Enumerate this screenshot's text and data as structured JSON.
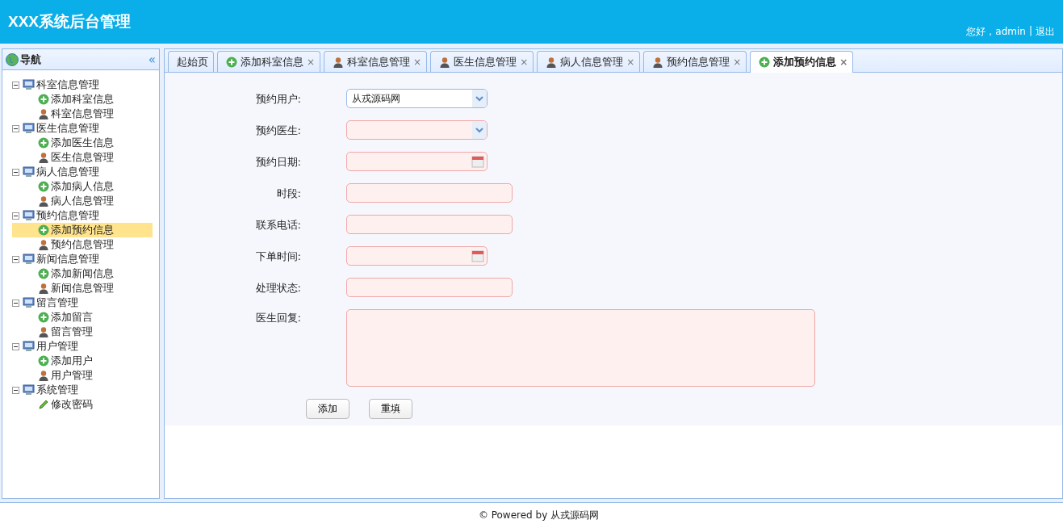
{
  "header": {
    "title": "XXX系统后台管理",
    "greeting": "您好，admin",
    "separator": "|",
    "logout": "退出"
  },
  "sidebar": {
    "title": "导航",
    "collapse": "«",
    "tree": [
      {
        "label": "科室信息管理",
        "expanded": true,
        "children": [
          {
            "label": "添加科室信息",
            "kind": "add",
            "selected": false
          },
          {
            "label": "科室信息管理",
            "kind": "user",
            "selected": false
          }
        ]
      },
      {
        "label": "医生信息管理",
        "expanded": true,
        "children": [
          {
            "label": "添加医生信息",
            "kind": "add",
            "selected": false
          },
          {
            "label": "医生信息管理",
            "kind": "user",
            "selected": false
          }
        ]
      },
      {
        "label": "病人信息管理",
        "expanded": true,
        "children": [
          {
            "label": "添加病人信息",
            "kind": "add",
            "selected": false
          },
          {
            "label": "病人信息管理",
            "kind": "user",
            "selected": false
          }
        ]
      },
      {
        "label": "预约信息管理",
        "expanded": true,
        "children": [
          {
            "label": "添加预约信息",
            "kind": "add",
            "selected": true
          },
          {
            "label": "预约信息管理",
            "kind": "user",
            "selected": false
          }
        ]
      },
      {
        "label": "新闻信息管理",
        "expanded": true,
        "children": [
          {
            "label": "添加新闻信息",
            "kind": "add",
            "selected": false
          },
          {
            "label": "新闻信息管理",
            "kind": "user",
            "selected": false
          }
        ]
      },
      {
        "label": "留言管理",
        "expanded": true,
        "children": [
          {
            "label": "添加留言",
            "kind": "add",
            "selected": false
          },
          {
            "label": "留言管理",
            "kind": "user",
            "selected": false
          }
        ]
      },
      {
        "label": "用户管理",
        "expanded": true,
        "children": [
          {
            "label": "添加用户",
            "kind": "add",
            "selected": false
          },
          {
            "label": "用户管理",
            "kind": "user",
            "selected": false
          }
        ]
      },
      {
        "label": "系统管理",
        "expanded": true,
        "children": [
          {
            "label": "修改密码",
            "kind": "edit",
            "selected": false
          }
        ]
      }
    ]
  },
  "tabs": [
    {
      "label": "起始页",
      "kind": "home",
      "closable": false,
      "selected": false
    },
    {
      "label": "添加科室信息",
      "kind": "add",
      "closable": true,
      "selected": false
    },
    {
      "label": "科室信息管理",
      "kind": "user",
      "closable": true,
      "selected": false
    },
    {
      "label": "医生信息管理",
      "kind": "user",
      "closable": true,
      "selected": false
    },
    {
      "label": "病人信息管理",
      "kind": "user",
      "closable": true,
      "selected": false
    },
    {
      "label": "预约信息管理",
      "kind": "user",
      "closable": true,
      "selected": false
    },
    {
      "label": "添加预约信息",
      "kind": "add",
      "closable": true,
      "selected": true
    }
  ],
  "tab_close": "×",
  "form": {
    "fields": [
      {
        "label": "预约用户:",
        "kind": "select",
        "value": "从戎源码网",
        "invalid": false
      },
      {
        "label": "预约医生:",
        "kind": "select",
        "invalid": true
      },
      {
        "label": "预约日期:",
        "kind": "date",
        "invalid": true
      },
      {
        "label": "时段:",
        "kind": "text",
        "invalid": true
      },
      {
        "label": "联系电话:",
        "kind": "text",
        "invalid": true
      },
      {
        "label": "下单时间:",
        "kind": "date",
        "invalid": true
      },
      {
        "label": "处理状态:",
        "kind": "text",
        "invalid": true
      },
      {
        "label": "医生回复:",
        "kind": "textarea",
        "invalid": true
      }
    ],
    "buttons": [
      "添加",
      "重填"
    ]
  },
  "footer": "© Powered by 从戎源码网"
}
